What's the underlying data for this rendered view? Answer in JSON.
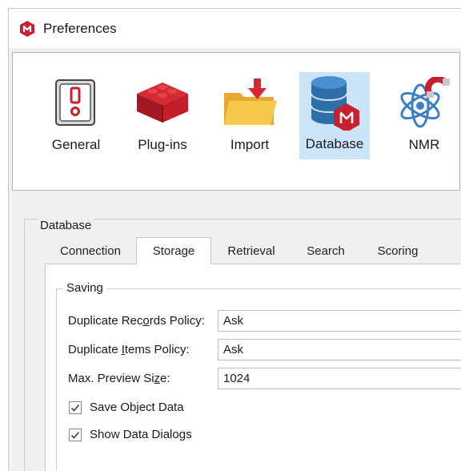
{
  "window": {
    "title": "Preferences"
  },
  "toolbar": {
    "items": [
      {
        "label": "General",
        "icon": "switch-icon"
      },
      {
        "label": "Plug-ins",
        "icon": "bricks-icon"
      },
      {
        "label": "Import",
        "icon": "folder-import-icon"
      },
      {
        "label": "Database",
        "icon": "database-icon",
        "selected": true
      },
      {
        "label": "NMR",
        "icon": "atom-magnet-icon"
      }
    ]
  },
  "database_group": {
    "legend": "Database"
  },
  "tabs": [
    {
      "label": "Connection"
    },
    {
      "label": "Storage",
      "active": true
    },
    {
      "label": "Retrieval"
    },
    {
      "label": "Search"
    },
    {
      "label": "Scoring"
    }
  ],
  "saving": {
    "legend": "Saving",
    "fields": [
      {
        "label_pre": "Duplicate Rec",
        "label_u": "o",
        "label_post": "rds Policy:",
        "value": "Ask"
      },
      {
        "label_pre": "Duplicate ",
        "label_u": "I",
        "label_post": "tems Policy:",
        "value": "Ask"
      },
      {
        "label_pre": "Max. Preview Si",
        "label_u": "z",
        "label_post": "e:",
        "value": "1024"
      }
    ],
    "checks": [
      {
        "label": "Save Object Data",
        "checked": true
      },
      {
        "label": "Show Data Dialogs",
        "checked": true
      }
    ]
  },
  "colors": {
    "brand_red": "#c8202f",
    "selection": "#cce4f7",
    "db_blue": "#2f6fa8"
  }
}
